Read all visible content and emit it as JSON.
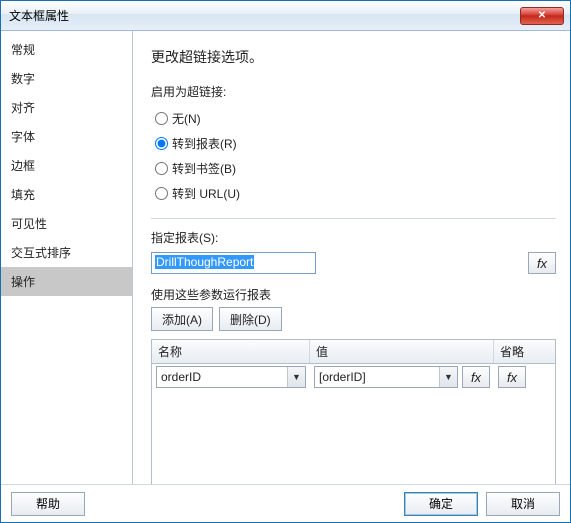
{
  "title": "文本框属性",
  "sidebar": {
    "items": [
      {
        "label": "常规"
      },
      {
        "label": "数字"
      },
      {
        "label": "对齐"
      },
      {
        "label": "字体"
      },
      {
        "label": "边框"
      },
      {
        "label": "填充"
      },
      {
        "label": "可见性"
      },
      {
        "label": "交互式排序"
      },
      {
        "label": "操作"
      }
    ],
    "selectedIndex": 8
  },
  "main": {
    "heading": "更改超链接选项。",
    "enableLabel": "启用为超链接:",
    "radios": {
      "none": "无(N)",
      "report": "转到报表(R)",
      "bookmark": "转到书签(B)",
      "url": "转到 URL(U)",
      "selected": "report"
    },
    "specifyReportLabel": "指定报表(S):",
    "specifyReportValue": "DrillThoughReport",
    "paramsHeading": "使用这些参数运行报表",
    "addBtn": "添加(A)",
    "deleteBtn": "删除(D)",
    "grid": {
      "headers": {
        "name": "名称",
        "value": "值",
        "omit": "省略"
      },
      "rows": [
        {
          "name": "orderID",
          "value": "[orderID]"
        }
      ]
    },
    "fx": "fx"
  },
  "footer": {
    "help": "帮助",
    "ok": "确定",
    "cancel": "取消"
  }
}
